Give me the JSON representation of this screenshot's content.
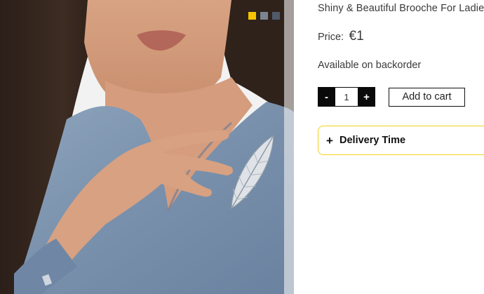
{
  "product": {
    "title": "Shiny & Beautiful Brooche For Ladies",
    "price_label": "Price:",
    "price_value": "€1",
    "availability": "Available on backorder",
    "image_alt": "Model wearing feather brooche on blue blouse"
  },
  "color_swatches": [
    {
      "name": "yellow",
      "color": "#f4c400"
    },
    {
      "name": "gray",
      "color": "#7b8591"
    },
    {
      "name": "slate",
      "color": "#4f5a6a"
    }
  ],
  "quantity": {
    "decrement_label": "-",
    "value": "1",
    "increment_label": "+"
  },
  "cart": {
    "add_label": "Add to cart"
  },
  "delivery": {
    "icon": "plus-icon",
    "label": "Delivery Time",
    "accent_color": "#f2d21b"
  }
}
